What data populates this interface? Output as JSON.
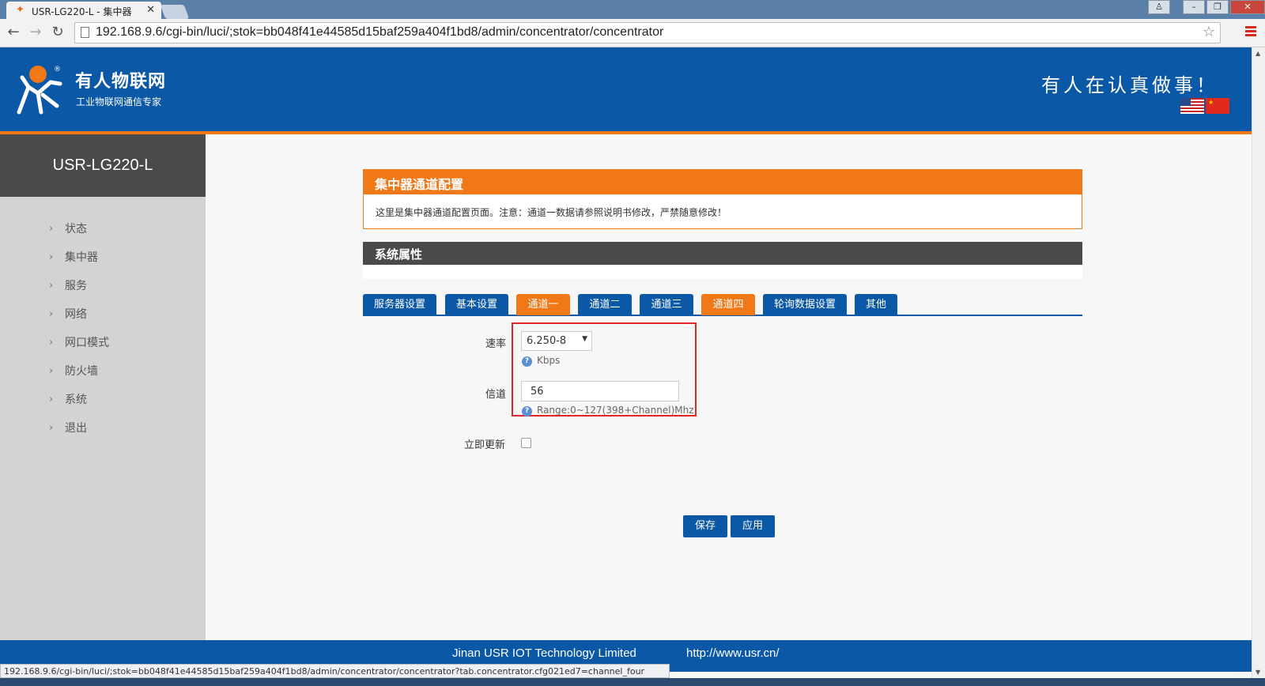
{
  "browser": {
    "tab_title": "USR-LG220-L - 集中器",
    "tab_close": "✕",
    "url": "192.168.9.6/cgi-bin/luci/;stok=bb048f41e44585d15baf259a404f1bd8/admin/concentrator/concentrator",
    "status_url": "192.168.9.6/cgi-bin/luci/;stok=bb048f41e44585d15baf259a404f1bd8/admin/concentrator/concentrator?tab.concentrator.cfg021ed7=channel_four"
  },
  "header": {
    "brand_name": "有人物联网",
    "brand_sub": "工业物联网通信专家",
    "slogan": "有人在认真做事！"
  },
  "sidebar": {
    "device": "USR-LG220-L",
    "items": [
      {
        "label": "状态"
      },
      {
        "label": "集中器"
      },
      {
        "label": "服务"
      },
      {
        "label": "网络"
      },
      {
        "label": "网口模式"
      },
      {
        "label": "防火墙"
      },
      {
        "label": "系统"
      },
      {
        "label": "退出"
      }
    ]
  },
  "main": {
    "panel_title": "集中器通道配置",
    "panel_desc": "这里是集中器通道配置页面。注意：通道一数据请参照说明书修改，严禁随意修改！",
    "section_title": "系统属性",
    "tabs": [
      {
        "label": "服务器设置",
        "active": false
      },
      {
        "label": "基本设置",
        "active": false
      },
      {
        "label": "通道一",
        "active": true
      },
      {
        "label": "通道二",
        "active": false
      },
      {
        "label": "通道三",
        "active": false
      },
      {
        "label": "通道四",
        "active": true
      },
      {
        "label": "轮询数据设置",
        "active": false
      },
      {
        "label": "其他",
        "active": false
      }
    ],
    "rate": {
      "label": "速率",
      "value": "6.250-8",
      "help": "Kbps"
    },
    "channel": {
      "label": "信道",
      "value": "56",
      "help": "Range:0~127(398+Channel)Mhz"
    },
    "update_now": {
      "label": "立即更新",
      "checked": false
    },
    "save_label": "保存",
    "apply_label": "应用"
  },
  "footer": {
    "company": "Jinan USR IOT Technology Limited",
    "url": "http://www.usr.cn/"
  },
  "colors": {
    "brand_blue": "#0b58a6",
    "accent_orange": "#f07817",
    "highlight_red": "#e0262a",
    "sidebar_dark": "#4a4a4a"
  }
}
